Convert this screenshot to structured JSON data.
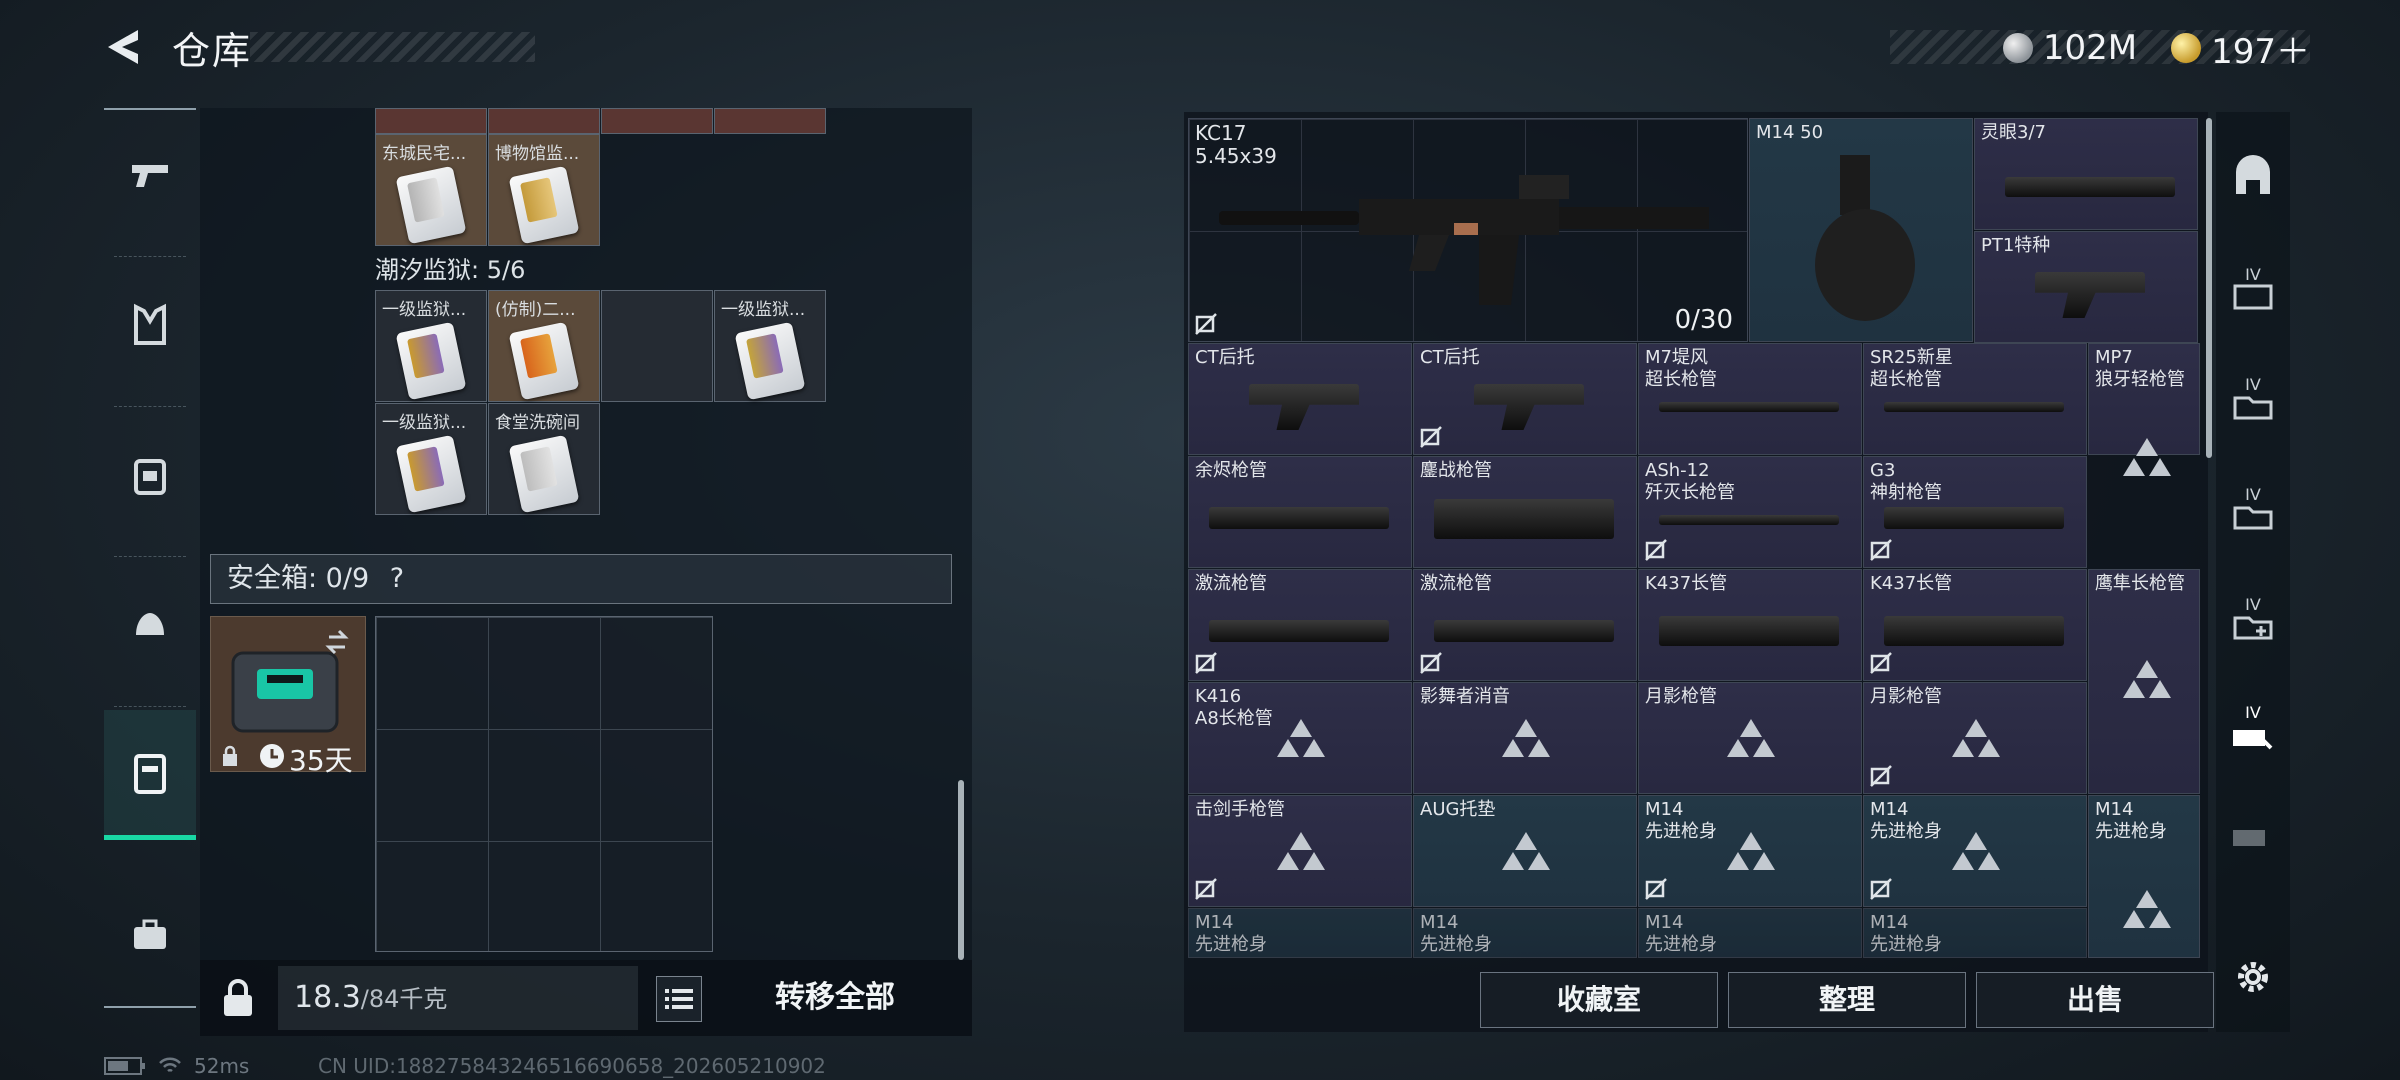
{
  "header": {
    "title": "仓库",
    "currency_silver": "102M",
    "currency_gold": "197＋"
  },
  "left_nav": [
    "weapon",
    "armor-vest",
    "backpack",
    "helmet",
    "safe-box",
    "toolbox"
  ],
  "inventory": {
    "row_top": [
      "",
      "",
      "",
      ""
    ],
    "row1": [
      "东城民宅...",
      "博物馆监..."
    ],
    "section_title": "潮汐监狱: 5/6",
    "row2": [
      "一级监狱...",
      "(仿制)二...",
      "",
      "一级监狱..."
    ],
    "row3": [
      "一级监狱...",
      "食堂洗碗间"
    ]
  },
  "safe": {
    "label": "安全箱: 0/9",
    "help": "?",
    "time": "35天"
  },
  "bottom_left": {
    "weight": "18.3",
    "weight_cap": "/84千克",
    "transfer": "转移全部"
  },
  "right_grid": {
    "big_weapon": {
      "name": "KC17",
      "caliber": "5.45x39",
      "ammo": "0/30"
    },
    "mag": "M14 50",
    "scope": "灵眼3/7",
    "stock_pt1": "PT1特种",
    "rows": [
      [
        "CT后托",
        "CT后托",
        "M7堤风\n超长枪管",
        "SR25新星\n超长枪管",
        "MP7\n狼牙轻枪管"
      ],
      [
        "余烬枪管",
        "鏖战枪管",
        "ASh-12\n歼灭长枪管",
        "G3\n神射枪管",
        ""
      ],
      [
        "激流枪管",
        "激流枪管",
        "K437长管",
        "K437长管",
        "鹰隼长枪管"
      ],
      [
        "K416\nA8长枪管",
        "影舞者消音",
        "月影枪管",
        "月影枪管",
        ""
      ],
      [
        "击剑手枪管",
        "AUG托垫",
        "M14\n先进枪身",
        "M14\n先进枪身",
        "M14\n先进枪身"
      ],
      [
        "M14\n先进枪身",
        "M14\n先进枪身",
        "M14\n先进枪身",
        "M14\n先进枪身",
        ""
      ]
    ]
  },
  "right_buttons": [
    "收藏室",
    "整理",
    "出售"
  ],
  "right_nav": [
    "IV",
    "IV",
    "IV",
    "IV",
    "IV"
  ],
  "status": {
    "ping": "52ms",
    "uid": "CN UID:188275843246516690658_202605210902"
  }
}
